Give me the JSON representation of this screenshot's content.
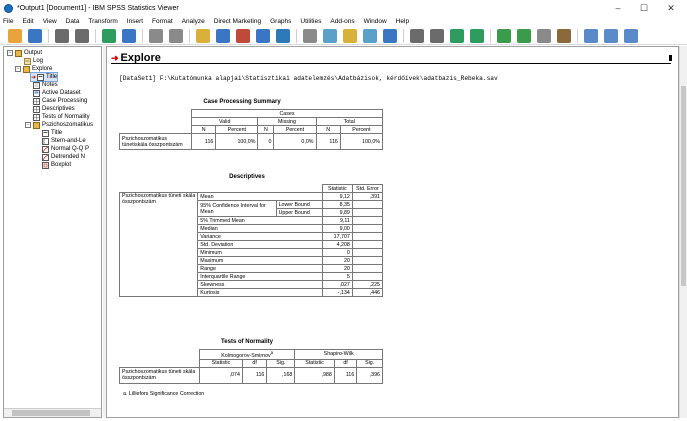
{
  "window": {
    "title": "*Output1 [Document1] - IBM SPSS Statistics Viewer",
    "minimize": "–",
    "maximize": "☐",
    "close": "✕"
  },
  "menu": [
    "File",
    "Edit",
    "View",
    "Data",
    "Transform",
    "Insert",
    "Format",
    "Analyze",
    "Direct Marketing",
    "Graphs",
    "Utilities",
    "Add-ons",
    "Window",
    "Help"
  ],
  "toolbar": {
    "icons": [
      "open-icon",
      "save-icon",
      "print-icon",
      "print-preview-icon",
      "export-icon",
      "recall-dialog-icon",
      "undo-icon",
      "redo-icon",
      "goto-data-icon",
      "goto-case-icon",
      "goto-variable-icon",
      "variables-icon",
      "show-all-icon",
      "select-cases-icon",
      "weight-cases-icon",
      "value-labels-icon",
      "use-sets-icon",
      "spelling-icon",
      "insert-output-icon",
      "designate-window-icon",
      "promote-icon",
      "demote-icon",
      "expand-icon",
      "collapse-icon",
      "show-icon",
      "hide-icon",
      "insert-heading-icon",
      "insert-title-icon",
      "insert-text-icon"
    ],
    "colors": [
      "#e8a33a",
      "#3a76c4",
      "#6b6b6b",
      "#6b6b6b",
      "#2e9c5e",
      "#3a76c4",
      "#8a8a8a",
      "#8a8a8a",
      "#d9b13a",
      "#3a76c4",
      "#c04a3a",
      "#3a76c4",
      "#2e7ab8",
      "#8a8a8a",
      "#5aa0c8",
      "#d9b13a",
      "#5aa0c8",
      "#3a76c4",
      "#6b6b6b",
      "#6b6b6b",
      "#2e9c5e",
      "#2e9c5e",
      "#3a9c4a",
      "#3a9c4a",
      "#8a8a8a",
      "#8a6a3a",
      "#5a8ac8",
      "#5a8ac8",
      "#5a8ac8"
    ]
  },
  "navigator": {
    "items": [
      {
        "label": "Output",
        "icon": "output-book-icon"
      },
      {
        "label": "Log",
        "icon": "log-icon"
      },
      {
        "label": "Explore",
        "icon": "explore-book-icon"
      },
      {
        "label": "Title",
        "icon": "title-icon"
      },
      {
        "label": "Notes",
        "icon": "notes-icon"
      },
      {
        "label": "Active Dataset",
        "icon": "dataset-icon"
      },
      {
        "label": "Case Processing",
        "icon": "table-icon"
      },
      {
        "label": "Descriptives",
        "icon": "table-icon"
      },
      {
        "label": "Tests of Normality",
        "icon": "table-icon"
      },
      {
        "label": "Pszichoszomatikus",
        "icon": "folder-book-icon"
      },
      {
        "label": "Title",
        "icon": "title-icon"
      },
      {
        "label": "Stem-and-Le",
        "icon": "stem-leaf-icon"
      },
      {
        "label": "Normal Q-Q P",
        "icon": "chart-icon"
      },
      {
        "label": "Detrended N",
        "icon": "chart-icon"
      },
      {
        "label": "Boxplot",
        "icon": "chart-icon"
      }
    ]
  },
  "content": {
    "heading": "Explore",
    "dataset_line": "[DataSet1] F:\\Kutatómunka alapjai\\Statisztikai adatelemzés\\Adatbázisok, kérdőívek\\adatbazis_Rebeka.sav"
  },
  "case_processing": {
    "title": "Case Processing Summary",
    "cases_header": "Cases",
    "groups": [
      "Valid",
      "Missing",
      "Total"
    ],
    "subheaders": [
      "N",
      "Percent",
      "N",
      "Percent",
      "N",
      "Percent"
    ],
    "row_label": "Pszichoszomatikus tünetiskála összpontszám",
    "values": [
      "116",
      "100,0%",
      "0",
      "0,0%",
      "116",
      "100,0%"
    ]
  },
  "descriptives": {
    "title": "Descriptives",
    "col_statistic": "Statistic",
    "col_std_error": "Std. Error",
    "row_label": "Pszichoszomatikus tüneti skála összpontszám",
    "rows": [
      {
        "label": "Mean",
        "sub": "",
        "stat": "9,12",
        "se": ",391"
      },
      {
        "label": "95% Confidence Interval for Mean",
        "sub": "Lower Bound",
        "stat": "8,35",
        "se": ""
      },
      {
        "label": "",
        "sub": "Upper Bound",
        "stat": "9,89",
        "se": ""
      },
      {
        "label": "5% Trimmed Mean",
        "sub": "",
        "stat": "9,11",
        "se": ""
      },
      {
        "label": "Median",
        "sub": "",
        "stat": "9,00",
        "se": ""
      },
      {
        "label": "Variance",
        "sub": "",
        "stat": "17,707",
        "se": ""
      },
      {
        "label": "Std. Deviation",
        "sub": "",
        "stat": "4,208",
        "se": ""
      },
      {
        "label": "Minimum",
        "sub": "",
        "stat": "0",
        "se": ""
      },
      {
        "label": "Maximum",
        "sub": "",
        "stat": "20",
        "se": ""
      },
      {
        "label": "Range",
        "sub": "",
        "stat": "20",
        "se": ""
      },
      {
        "label": "Interquartile Range",
        "sub": "",
        "stat": "5",
        "se": ""
      },
      {
        "label": "Skewness",
        "sub": "",
        "stat": ",027",
        "se": ",225"
      },
      {
        "label": "Kurtosis",
        "sub": "",
        "stat": "-,134",
        "se": ",446"
      }
    ]
  },
  "normality": {
    "title": "Tests of Normality",
    "groups": [
      "Kolmogorov-Smirnov",
      "Shapiro-Wilk"
    ],
    "ks_superscript": "a",
    "subheaders": [
      "Statistic",
      "df",
      "Sig.",
      "Statistic",
      "df",
      "Sig."
    ],
    "row_label": "Pszichoszomatikus tüneti skála összpontszám",
    "values": [
      ",074",
      "116",
      ",168",
      ",988",
      "116",
      ",396"
    ],
    "footnote": "a. Lilliefors Significance Correction"
  }
}
